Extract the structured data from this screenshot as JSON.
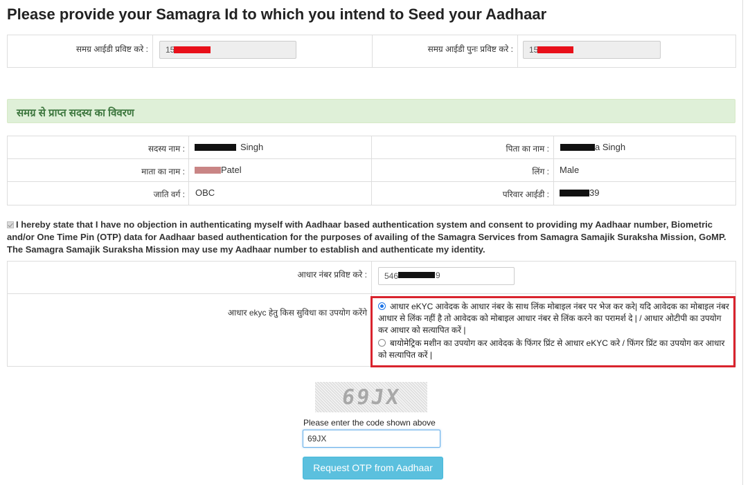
{
  "page": {
    "title": "Please provide your Samagra Id to which you intend to Seed your Aadhaar"
  },
  "samagra_entry": {
    "id_label": "समग्र आईडी प्रविष्ट करे :",
    "id_value": "156",
    "reenter_label": "समग्र आईडी पुनः प्रविष्ट करे :",
    "reenter_value": "156"
  },
  "member_section": {
    "heading": "समग्र से प्राप्त सदस्य का विवरण",
    "member_name_label": "सदस्य नाम :",
    "member_name_value": "Singh",
    "father_name_label": "पिता का नाम :",
    "father_name_value": "a Singh",
    "mother_name_label": "माता का नाम :",
    "mother_name_value": "Patel",
    "gender_label": "लिंग :",
    "gender_value": "Male",
    "caste_label": "जाति वर्ग :",
    "caste_value": "OBC",
    "family_id_label": "परिवार आईडी :",
    "family_id_value": "39"
  },
  "consent": {
    "checked": true,
    "text": "I hereby state that I have no objection in authenticating myself with Aadhaar based authentication system and consent to providing my Aadhaar number, Biometric and/or One Time Pin (OTP) data for Aadhaar based authentication for the purposes of availing of the Samagra Services from Samagra Samajik Suraksha Mission, GoMP. The Samagra Samajik Suraksha Mission may use my Aadhaar number to establish and authenticate my identity."
  },
  "aadhaar": {
    "number_label": "आधार नंबर प्रविष्ट करे :",
    "number_value": "546",
    "number_suffix": "9",
    "ekyc_label": "आधार ekyc हेतु किस सुविधा का उपयोग करेंगे",
    "option_otp": "आधार eKYC आवेदक के आधार नंबर के साथ लिंक मोबाइल नंबर पर भेज कर करे| यदि आवेदक का मोबाइल नंबर आधार से लिंक नहीं है तो आवेदक को मोबाइल आधार नंबर से लिंक करने का परामर्श दे | / आधार ओटीपी का उपयोग कर आधार को सत्यापित करें |",
    "option_biometric": "बायोमेट्रिक मशीन का उपयोग कर आवेदक के फिंगर प्रिंट से आधार eKYC करे / फिंगर प्रिंट का उपयोग कर आधार को सत्यापित करें |",
    "selected": "otp"
  },
  "captcha": {
    "image_text": "69JX",
    "label": "Please enter the code shown above",
    "input_value": "69JX"
  },
  "actions": {
    "request_otp_label": "Request OTP from Aadhaar"
  },
  "colors": {
    "section_heading_bg": "#dff0d8",
    "section_heading_text": "#3c763d",
    "highlight_border": "#d9232d",
    "button_bg": "#5bc0de",
    "redaction_red": "#e8101a"
  }
}
